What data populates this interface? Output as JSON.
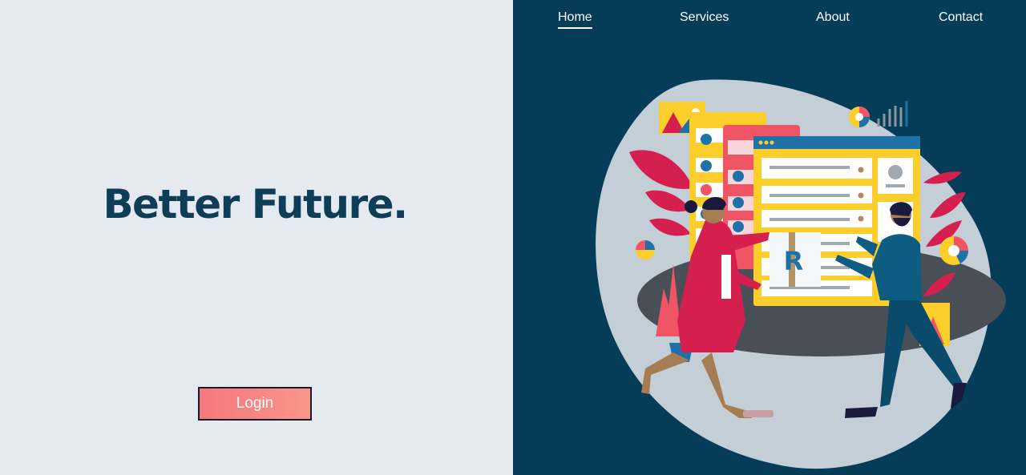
{
  "nav": {
    "items": [
      {
        "label": "Home",
        "active": true
      },
      {
        "label": "Services",
        "active": false
      },
      {
        "label": "About",
        "active": false
      },
      {
        "label": "Contact",
        "active": false
      }
    ]
  },
  "hero": {
    "headline": "Better Future.",
    "login_label": "Login"
  },
  "illustration": {
    "logo_letter": "R",
    "colors": {
      "left_bg": "#e5e9f0",
      "right_bg": "#053c58",
      "headline": "#0e3d58",
      "button": "#f5777c",
      "blob": "#c3ced7",
      "yellow": "#fbce2b",
      "pink": "#f05565",
      "crimson": "#d11f4e",
      "blue": "#1f72a8"
    }
  }
}
